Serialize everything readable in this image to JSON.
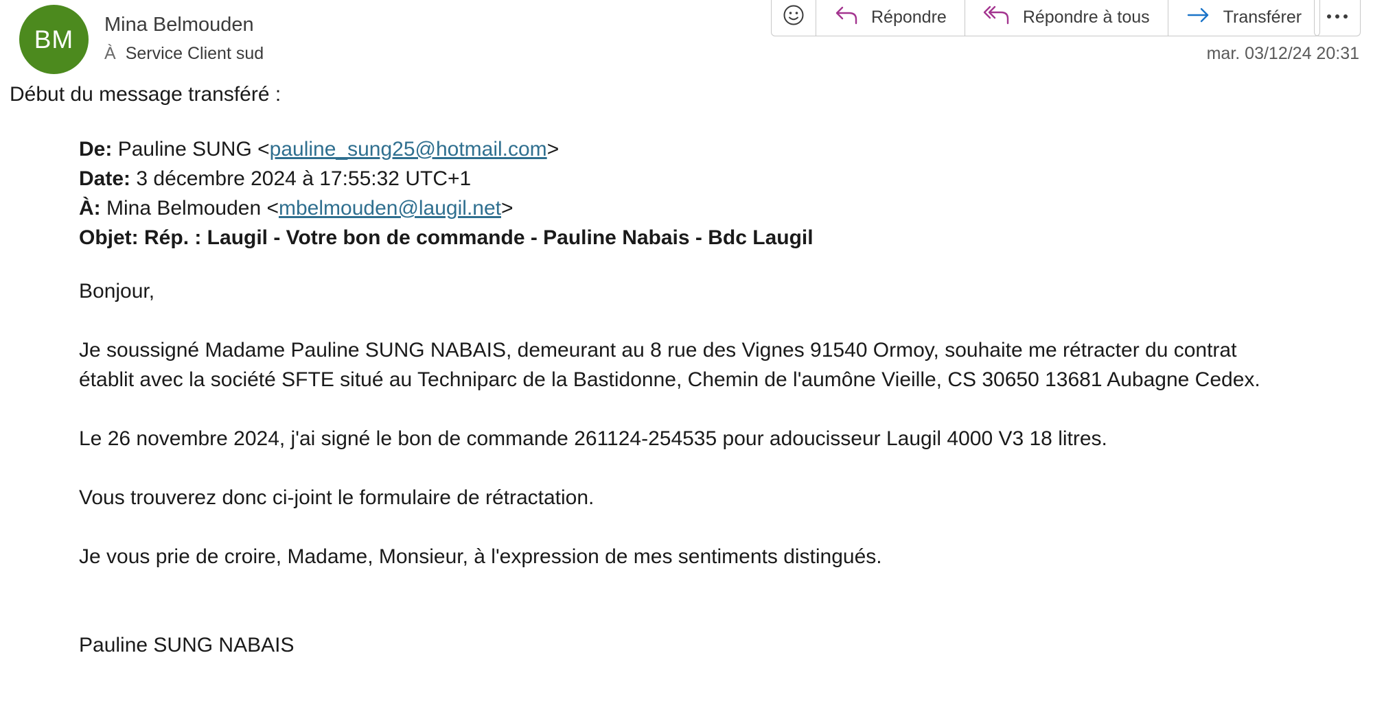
{
  "header": {
    "avatar_initials": "BM",
    "avatar_color": "#4c8a1e",
    "sender_name": "Mina Belmouden",
    "to_label": "À",
    "to_value": "Service Client sud",
    "timestamp": "mar. 03/12/24 20:31"
  },
  "toolbar": {
    "emoji_icon": "smiley-icon",
    "reply_label": "Répondre",
    "reply_all_label": "Répondre à tous",
    "forward_label": "Transférer",
    "more_icon": "more-icon"
  },
  "message": {
    "intro": "Début du message transféré :",
    "forwarded": {
      "from_label": "De:",
      "from_name": "Pauline SUNG <",
      "from_email": "pauline_sung25@hotmail.com",
      "from_suffix": ">",
      "date_label": "Date:",
      "date_value": "3 décembre 2024 à 17:55:32 UTC+1",
      "to_label": "À:",
      "to_name": "Mina Belmouden <",
      "to_email": "mbelmouden@laugil.net",
      "to_suffix": ">",
      "subject_label": "Objet:",
      "subject_value": "Rép. : Laugil - Votre bon de commande - Pauline Nabais - Bdc Laugil"
    },
    "greeting": "Bonjour,",
    "paragraph_1_line_1": "Je soussigné Madame Pauline SUNG NABAIS, demeurant au 8 rue des Vignes 91540 Ormoy, souhaite me rétracter du contrat",
    "paragraph_1_line_2": "établit avec la société SFTE situé au Techniparc de la Bastidonne, Chemin de l'aumône Vieille, CS 30650 13681 Aubagne Cedex.",
    "paragraph_2": "Le 26 novembre 2024, j'ai signé le bon de commande 261124-254535 pour adoucisseur Laugil 4000 V3 18 litres.",
    "paragraph_3": "Vous trouverez donc ci-joint le formulaire de rétractation.",
    "closing": "Je vous prie de croire, Madame, Monsieur, à l'expression de mes sentiments distingués.",
    "signature": "Pauline SUNG NABAIS"
  }
}
